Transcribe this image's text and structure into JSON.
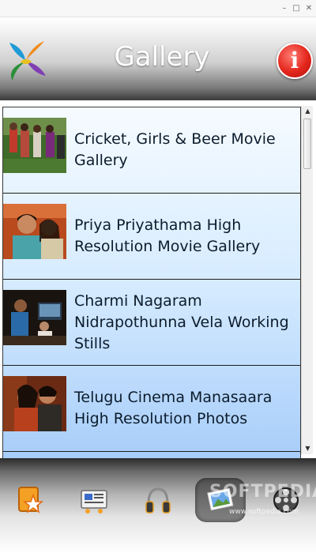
{
  "window": {
    "minimize": "–",
    "maximize": "□",
    "close": "✕"
  },
  "header": {
    "title": "Gallery",
    "info_label": "i",
    "logo_icon": "app-logo-icon"
  },
  "gallery": {
    "items": [
      {
        "title": "Cricket, Girls & Beer Movie Gallery"
      },
      {
        "title": "Priya Priyathama High Resolution Movie Gallery"
      },
      {
        "title": "Charmi Nagaram Nidrapothunna Vela Working Stills"
      },
      {
        "title": "Telugu Cinema Manasaara High Resolution Photos"
      }
    ]
  },
  "scrollbar": {
    "up": "▲",
    "down": "▼",
    "position": 0.03
  },
  "toolbar": {
    "buttons": [
      {
        "icon": "favorites-star-icon"
      },
      {
        "icon": "news-icon"
      },
      {
        "icon": "music-headphones-icon"
      },
      {
        "icon": "gallery-photos-icon",
        "active": true
      },
      {
        "icon": "video-reel-icon"
      }
    ]
  },
  "watermark": {
    "text": "SOFTPEDIA",
    "url": "www.softpedia.com"
  }
}
